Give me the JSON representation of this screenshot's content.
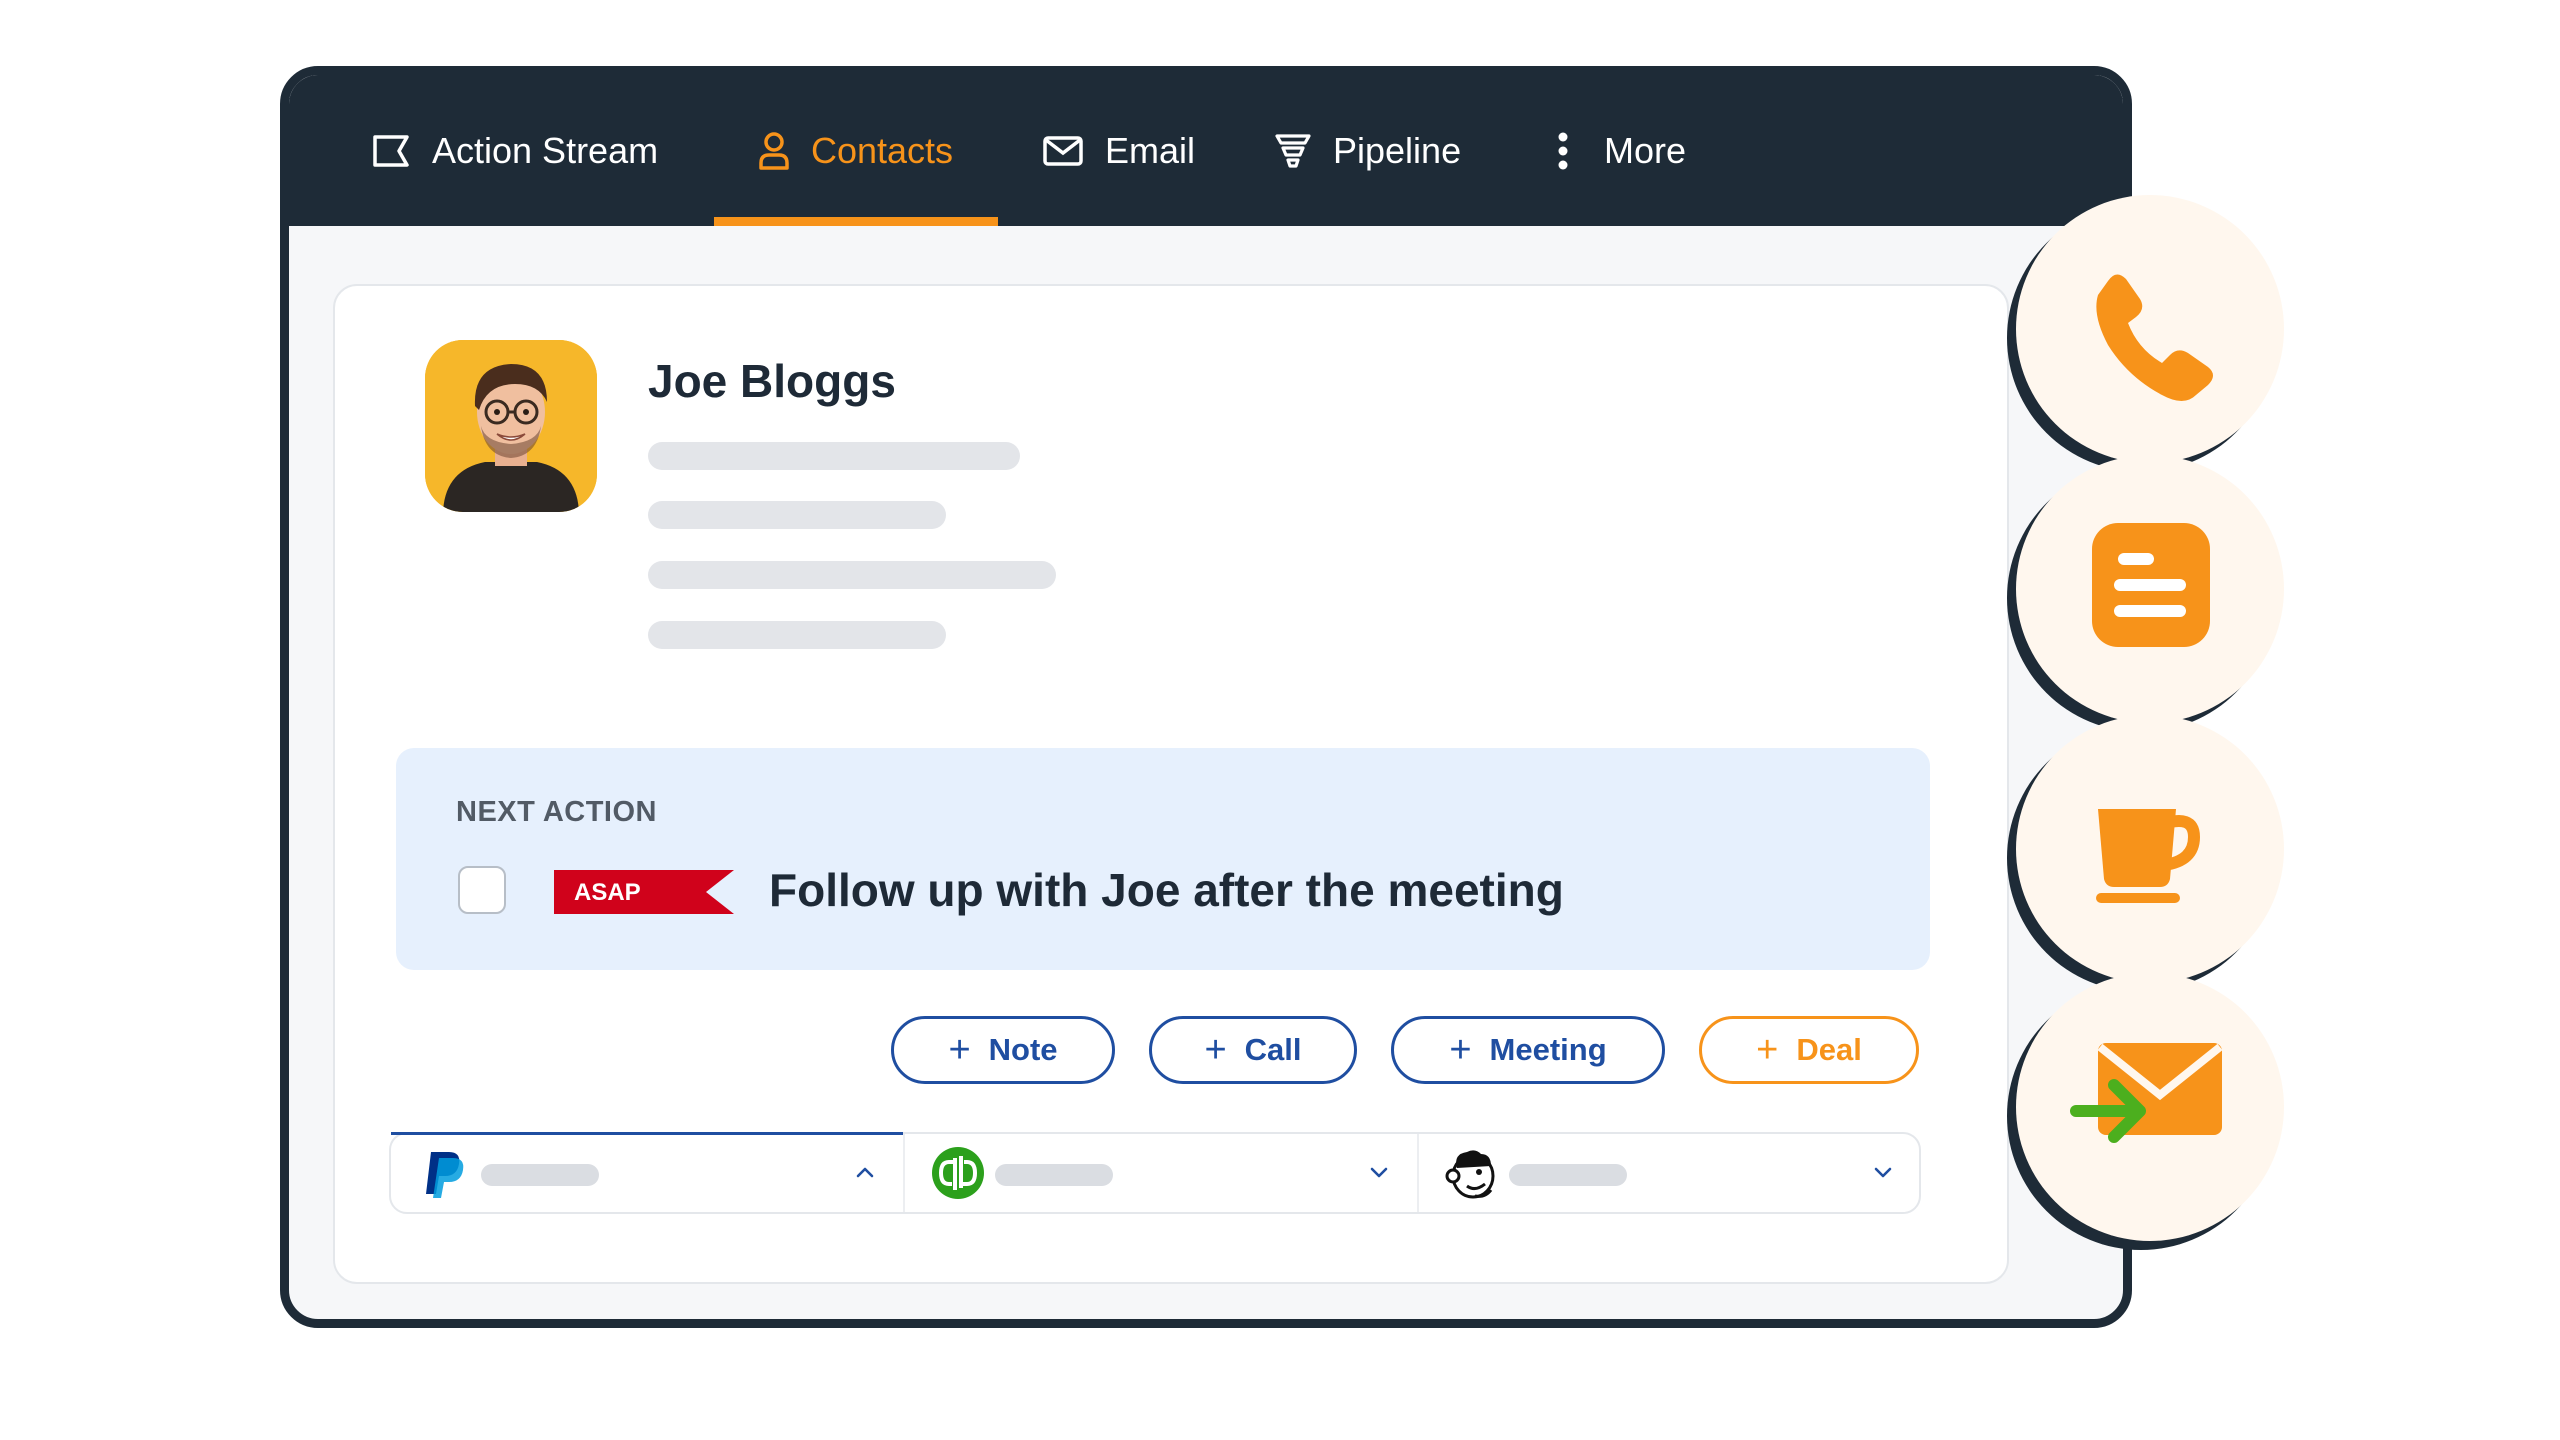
{
  "nav": {
    "tabs": [
      {
        "label": "Action Stream",
        "icon": "action-stream-icon"
      },
      {
        "label": "Contacts",
        "icon": "person-icon",
        "active": true
      },
      {
        "label": "Email",
        "icon": "envelope-icon"
      },
      {
        "label": "Pipeline",
        "icon": "funnel-icon"
      },
      {
        "label": "More",
        "icon": "vertical-dots-icon"
      }
    ]
  },
  "contact": {
    "name": "Joe Bloggs",
    "avatar": "person-photo"
  },
  "next_action": {
    "label": "NEXT ACTION",
    "badge": "ASAP",
    "title": "Follow up with Joe after the meeting",
    "checked": false
  },
  "quick_add": [
    {
      "label": "Note"
    },
    {
      "label": "Call"
    },
    {
      "label": "Meeting"
    },
    {
      "label": "Deal"
    }
  ],
  "integrations": [
    {
      "name": "paypal-logo",
      "expanded": true
    },
    {
      "name": "quickbooks-logo",
      "expanded": false
    },
    {
      "name": "mailchimp-logo",
      "expanded": false
    }
  ],
  "side_actions": [
    "phone-icon",
    "note-icon",
    "coffee-cup-icon",
    "incoming-mail-icon"
  ],
  "colors": {
    "nav_bg": "#1e2b37",
    "accent": "#f7931a",
    "primary_blue": "#1f4ea1",
    "next_action_bg": "#e6f0fd",
    "asap_red": "#d0021b",
    "side_circle_bg": "#fff7ee"
  }
}
